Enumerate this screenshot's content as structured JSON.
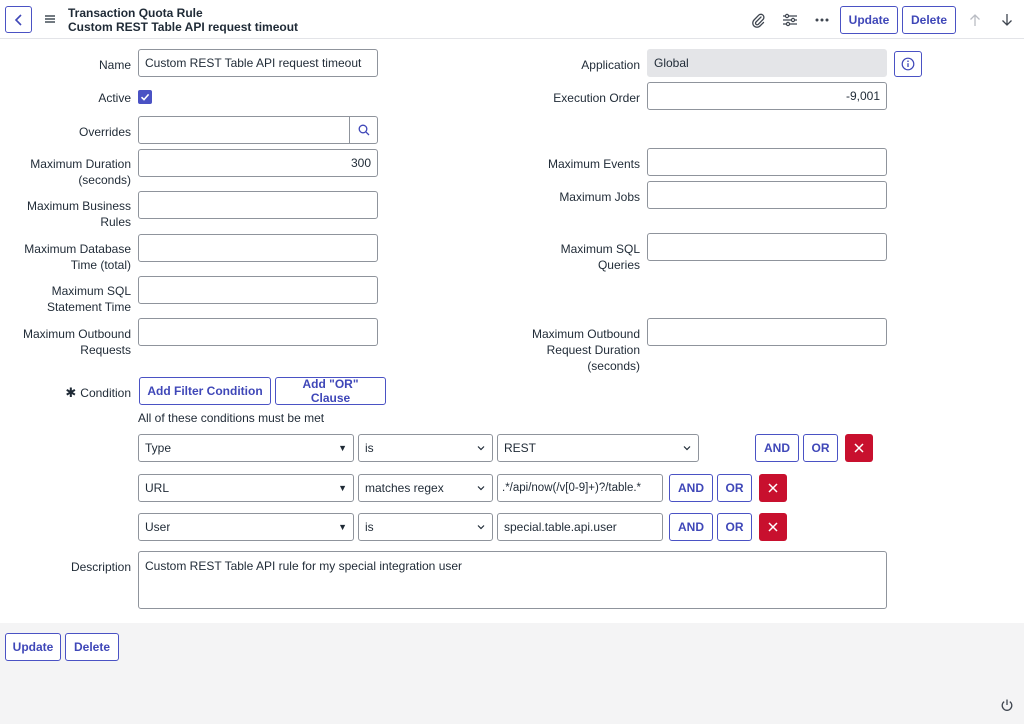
{
  "header": {
    "title": "Transaction Quota Rule",
    "subtitle": "Custom REST Table API request timeout",
    "update_label": "Update",
    "delete_label": "Delete"
  },
  "fields": {
    "name": {
      "label": "Name",
      "value": "Custom REST Table API request timeout"
    },
    "application": {
      "label": "Application",
      "value": "Global"
    },
    "active": {
      "label": "Active",
      "checked": true
    },
    "execution_order": {
      "label": "Execution Order",
      "value": "-9,001"
    },
    "overrides": {
      "label": "Overrides",
      "value": ""
    },
    "max_duration": {
      "label1": "Maximum Duration",
      "label2": "(seconds)",
      "value": "300"
    },
    "max_events": {
      "label": "Maximum Events",
      "value": ""
    },
    "max_business_rules": {
      "label1": "Maximum Business",
      "label2": "Rules",
      "value": ""
    },
    "max_jobs": {
      "label": "Maximum Jobs",
      "value": ""
    },
    "max_db_time": {
      "label1": "Maximum Database",
      "label2": "Time (total)",
      "value": ""
    },
    "max_sql_queries": {
      "label1": "Maximum SQL",
      "label2": "Queries",
      "value": ""
    },
    "max_sql_statement": {
      "label1": "Maximum SQL",
      "label2": "Statement Time",
      "value": ""
    },
    "max_outbound_requests": {
      "label1": "Maximum Outbound",
      "label2": "Requests",
      "value": ""
    },
    "max_outbound_duration": {
      "label1": "Maximum Outbound",
      "label2": "Request Duration",
      "label3": "(seconds)",
      "value": ""
    },
    "description": {
      "label": "Description",
      "value": "Custom REST Table API rule for my special integration user"
    }
  },
  "condition": {
    "required_mark": "✱",
    "label": "Condition",
    "add_filter_label": "Add Filter Condition",
    "add_or_label": "Add \"OR\" Clause",
    "all_met_text": "All of these conditions must be met",
    "and_label": "AND",
    "or_label": "OR",
    "rows": [
      {
        "field": "Type",
        "operator": "is",
        "value": "REST"
      },
      {
        "field": "URL",
        "operator": "matches regex",
        "value": ".*/api/now(/v[0-9]+)?/table.*"
      },
      {
        "field": "User",
        "operator": "is",
        "value": "special.table.api.user"
      }
    ]
  },
  "footer": {
    "update_label": "Update",
    "delete_label": "Delete"
  },
  "colors": {
    "accent": "#4a52c4",
    "danger": "#c8102e",
    "readonly_bg": "#e4e5e8"
  }
}
